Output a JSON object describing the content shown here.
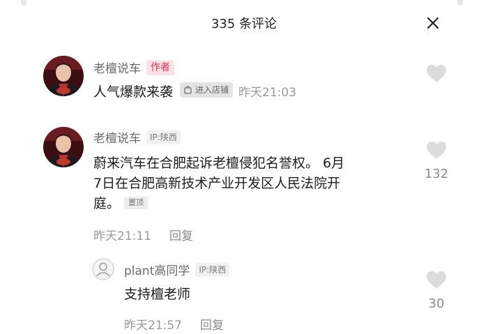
{
  "header": {
    "title": "335 条评论"
  },
  "comments": [
    {
      "username": "老檀说车",
      "badge": "作者",
      "text": "人气爆款来袭",
      "shop_button": "进入店铺",
      "time": "昨天21:03",
      "icons": {
        "shop": "shop-bag-icon",
        "like": "heart-icon"
      }
    },
    {
      "username": "老檀说车",
      "ip": "IP:陕西",
      "text_line1": "蔚来汽车在合肥起诉老檀侵犯名誉权。 6月",
      "text_line2": "7日在合肥高新技术产业开发区人民法院开",
      "text_line3": "庭。",
      "pinned": "置顶",
      "time": "昨天21:11",
      "reply_label": "回复",
      "like_count": "132"
    },
    {
      "username": "plant高同学",
      "ip": "IP:陕西",
      "text": "支持檀老师",
      "time": "昨天21:57",
      "reply_label": "回复",
      "like_count": "30"
    }
  ],
  "colors": {
    "accent": "#ee2e52",
    "muted": "#9a9a9a",
    "heart": "#dcdcdc"
  }
}
